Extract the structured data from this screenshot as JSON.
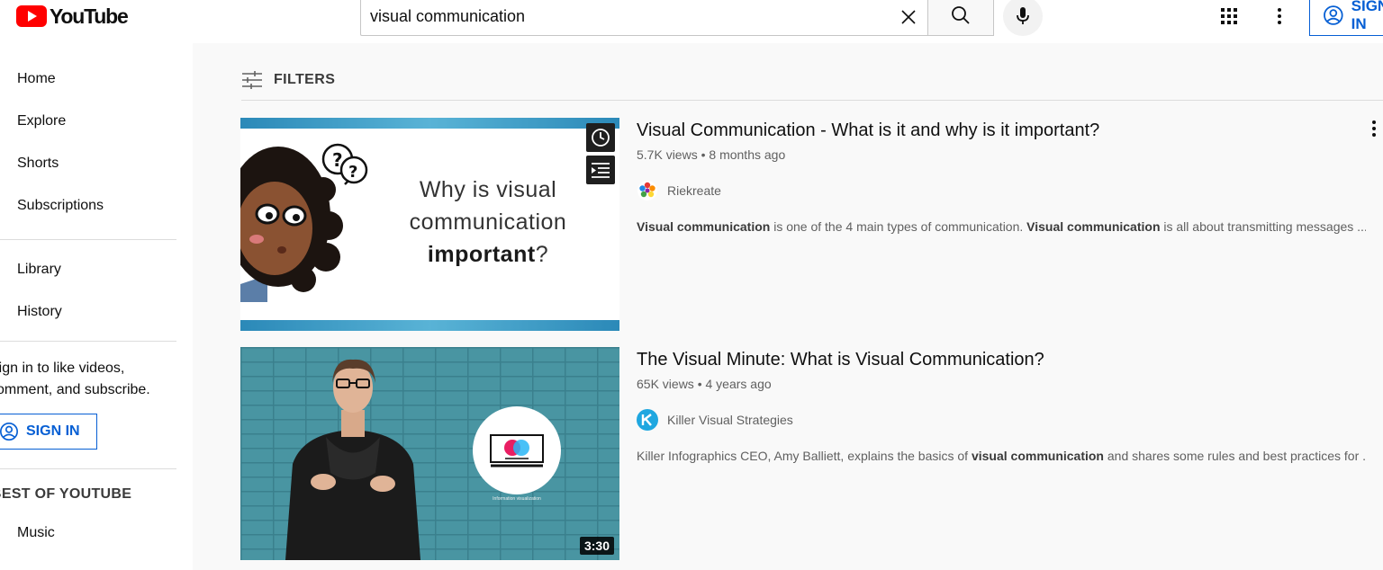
{
  "header": {
    "logo_text": "YouTube",
    "search_value": "visual communication",
    "signin_label": "SIGN IN",
    "accent": "#065fd4",
    "brand": "#ff0000"
  },
  "sidebar": {
    "primary": [
      {
        "label": "Home"
      },
      {
        "label": "Explore"
      },
      {
        "label": "Shorts"
      },
      {
        "label": "Subscriptions"
      }
    ],
    "secondary": [
      {
        "label": "Library"
      },
      {
        "label": "History"
      }
    ],
    "signin_prompt_line1": "Sign in to like videos,",
    "signin_prompt_line2": "comment, and subscribe.",
    "signin_label": "SIGN IN",
    "section_title": "BEST OF YOUTUBE",
    "section_items": [
      {
        "label": "Music"
      }
    ]
  },
  "filters": {
    "label": "FILTERS"
  },
  "results": [
    {
      "title": "Visual Communication - What is it and why is it important?",
      "views": "5.7K views",
      "age": "8 months ago",
      "channel": "Riekreate",
      "thumb_line1": "Why is visual",
      "thumb_line2": "communication",
      "thumb_line3_bold": "important",
      "thumb_line3_end": "?",
      "desc_parts": [
        {
          "text": "Visual communication",
          "bold": true
        },
        {
          "text": " is one of the 4 main types of communication. ",
          "bold": false
        },
        {
          "text": "Visual communication",
          "bold": true
        },
        {
          "text": " is all about transmitting messages ...",
          "bold": false
        }
      ]
    },
    {
      "title": "The Visual Minute: What is Visual Communication?",
      "views": "65K views",
      "age": "4 years ago",
      "channel": "Killer Visual Strategies",
      "duration": "3:30",
      "thumb_caption": "Information visualization",
      "desc_parts": [
        {
          "text": "Killer Infographics CEO, Amy Balliett, explains the basics of ",
          "bold": false
        },
        {
          "text": "visual communication",
          "bold": true
        },
        {
          "text": " and shares some rules and best practices for ...",
          "bold": false
        }
      ]
    }
  ]
}
